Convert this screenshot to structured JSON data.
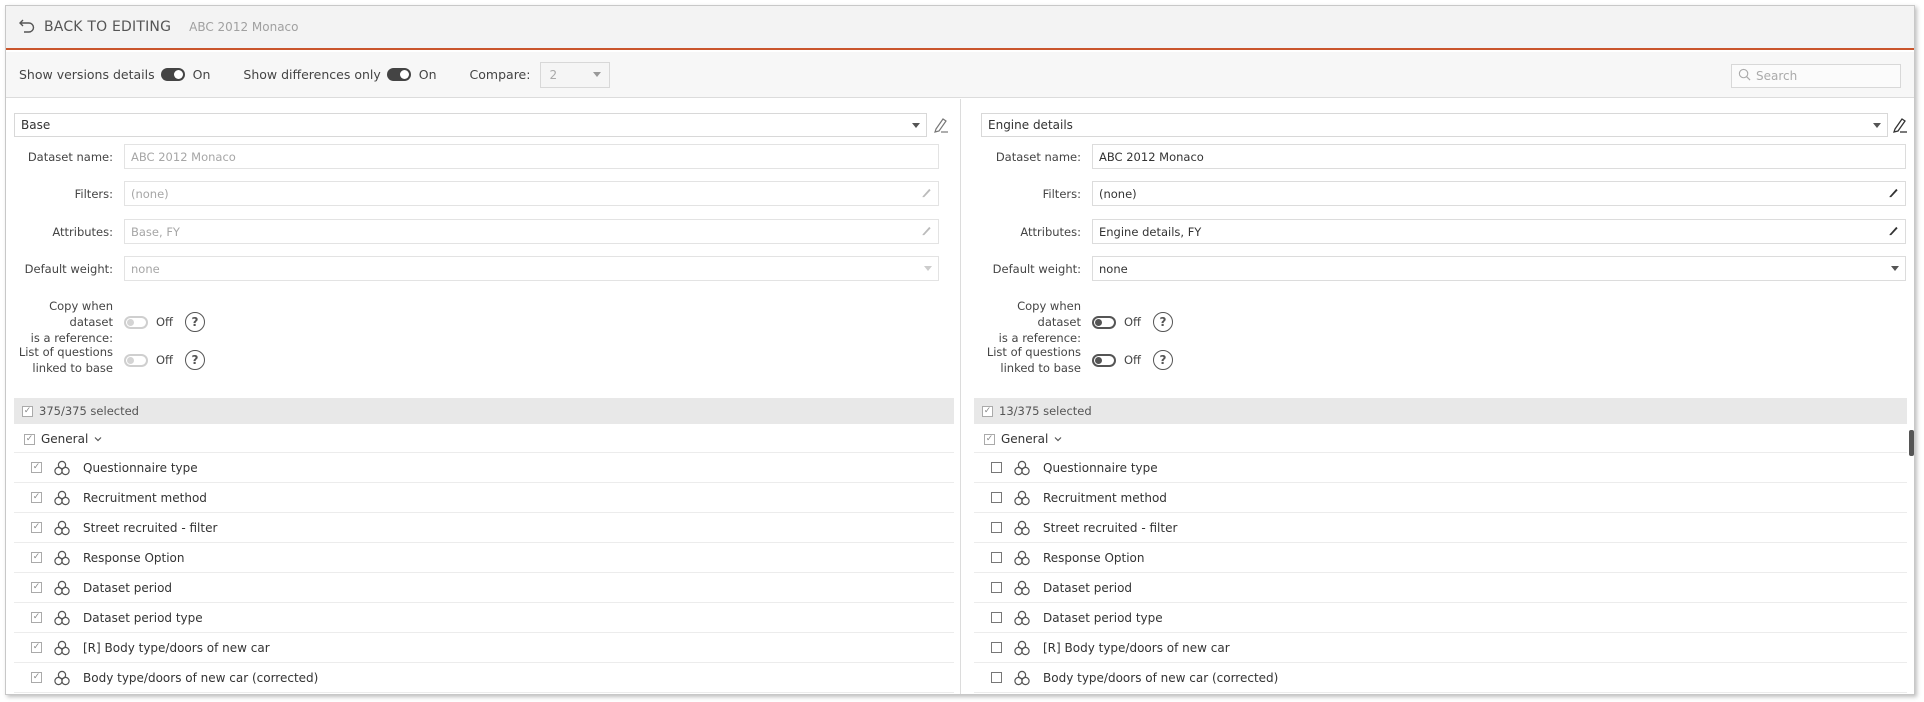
{
  "header": {
    "back_label": "BACK TO EDITING",
    "dataset_title": "ABC 2012 Monaco",
    "accent_color": "#c9552c"
  },
  "toolbar": {
    "show_versions_label": "Show versions details",
    "show_versions_state": "On",
    "show_diff_label": "Show differences only",
    "show_diff_state": "On",
    "compare_label": "Compare:",
    "compare_value": "2",
    "search_placeholder": "Search"
  },
  "left": {
    "select_value": "Base",
    "dataset_name_label": "Dataset name:",
    "dataset_name_value": "ABC 2012 Monaco",
    "filters_label": "Filters:",
    "filters_value": "(none)",
    "attributes_label": "Attributes:",
    "attributes_value": "Base, FY",
    "default_weight_label": "Default weight:",
    "default_weight_value": "none",
    "copy_label_1": "Copy when dataset",
    "copy_label_2": "is a reference:",
    "copy_state": "Off",
    "list_label_1": "List of questions",
    "list_label_2": "linked to base",
    "list_state": "Off",
    "selected_count": "375/375 selected",
    "group_label": "General",
    "items": [
      "Questionnaire type",
      "Recruitment method",
      "Street recruited - filter",
      "Response Option",
      "Dataset period",
      "Dataset period type",
      "[R] Body type/doors of new car",
      "Body type/doors of new car (corrected)"
    ]
  },
  "right": {
    "select_value": "Engine details",
    "dataset_name_label": "Dataset name:",
    "dataset_name_value": "ABC 2012 Monaco",
    "filters_label": "Filters:",
    "filters_value": "(none)",
    "attributes_label": "Attributes:",
    "attributes_value": "Engine details, FY",
    "default_weight_label": "Default weight:",
    "default_weight_value": "none",
    "copy_label_1": "Copy when dataset",
    "copy_label_2": "is a reference:",
    "copy_state": "Off",
    "list_label_1": "List of questions",
    "list_label_2": "linked to base",
    "list_state": "Off",
    "selected_count": "13/375 selected",
    "group_label": "General",
    "items": [
      "Questionnaire type",
      "Recruitment method",
      "Street recruited - filter",
      "Response Option",
      "Dataset period",
      "Dataset period type",
      "[R] Body type/doors of new car",
      "Body type/doors of new car (corrected)"
    ]
  }
}
